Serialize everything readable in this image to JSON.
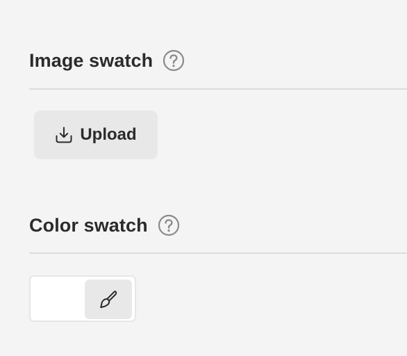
{
  "image_swatch": {
    "title": "Image swatch",
    "help_icon": "question-circle-icon",
    "upload_label": "Upload",
    "upload_icon": "download-tray-icon"
  },
  "color_swatch": {
    "title": "Color swatch",
    "help_icon": "question-circle-icon",
    "picker_icon": "paintbrush-icon",
    "preview_color": "#ffffff"
  },
  "colors": {
    "background": "#f4f4f4",
    "text": "#2b2b2b",
    "divider": "#dcdcdc",
    "button_bg": "#e8e8e8",
    "icon": "#8a8a8a"
  }
}
